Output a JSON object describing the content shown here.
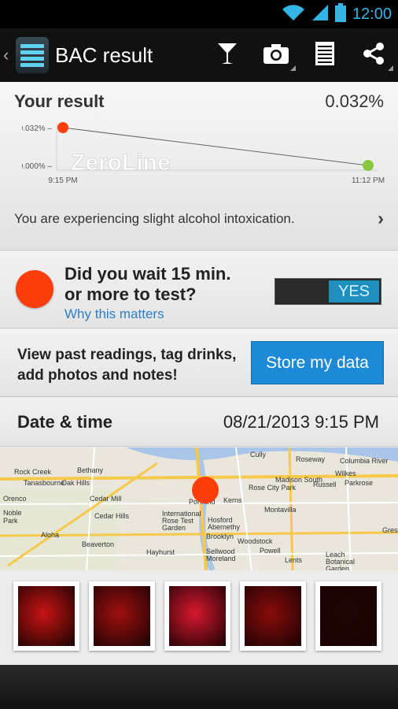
{
  "status_bar": {
    "time": "12:00"
  },
  "action_bar": {
    "title": "BAC result",
    "actions": [
      "drink-icon",
      "camera-icon",
      "notes-icon",
      "share-icon"
    ]
  },
  "result": {
    "label": "Your result",
    "value": "0.032%",
    "message": "You are experiencing slight alcohol intoxication."
  },
  "chart_data": {
    "type": "line",
    "title": "",
    "xlabel": "",
    "ylabel": "",
    "x": [
      "9:15 PM",
      "11:12 PM"
    ],
    "series": [
      {
        "values": [
          0.032,
          0.0
        ]
      }
    ],
    "y_ticks": [
      "0.032%",
      "0.000%"
    ],
    "ylim": [
      0,
      0.032
    ],
    "watermark": "ZeroLine",
    "colors": {
      "start": "#ff3d0a",
      "end": "#8cc63f",
      "line": "#666666"
    }
  },
  "wait": {
    "question": "Did you wait 15 min. or more to test?",
    "link": "Why this matters",
    "toggle_label": "YES",
    "toggle_on": true
  },
  "store": {
    "text": "View past readings, tag drinks, add photos and notes!",
    "button": "Store my data"
  },
  "datetime": {
    "label": "Date & time",
    "value": "08/21/2013 9:15 PM"
  },
  "map": {
    "labels": [
      "Cully",
      "Roseway",
      "Rock Creek",
      "Bethany",
      "Tanasbourne",
      "Oak Hills",
      "Orenco",
      "Cedar Mill",
      "Noble",
      "Park",
      "Cedar Hills",
      "Aloha",
      "Beaverton",
      "Portland",
      "International Rose Test Garden",
      "Kerns",
      "Hosford Abernethy",
      "Brooklyn",
      "Woodstock",
      "Sellwood Moreland",
      "Madison South",
      "Rose City Park",
      "Montavilla",
      "Russell",
      "Wilkes",
      "Parkrose",
      "Lents",
      "Gresham",
      "Leach Botanical Garden",
      "Columbia River",
      "Hayhurst",
      "Powell"
    ]
  },
  "photos": [
    {
      "color": "#c81414"
    },
    {
      "color": "#a01010"
    },
    {
      "color": "#d81830"
    },
    {
      "color": "#8a0c0c"
    },
    {
      "color": "#200404"
    }
  ]
}
